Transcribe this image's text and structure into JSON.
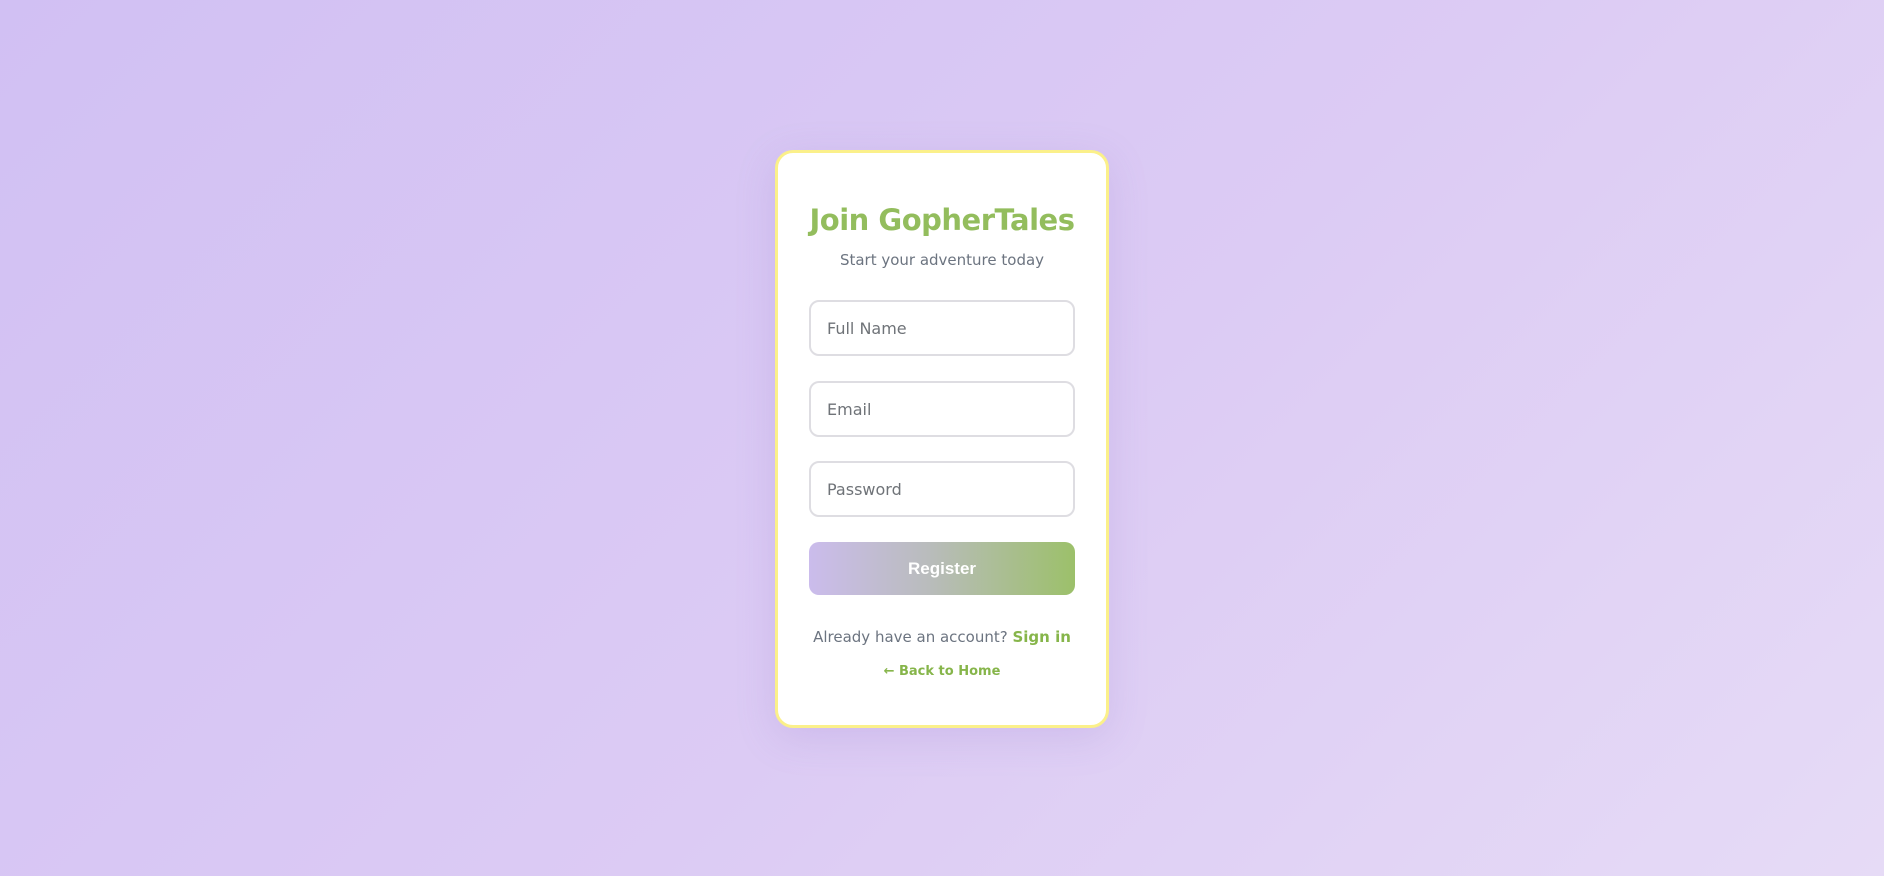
{
  "card": {
    "title": "Join GopherTales",
    "subtitle": "Start your adventure today"
  },
  "form": {
    "name_placeholder": "Full Name",
    "name_value": "",
    "email_placeholder": "Email",
    "email_value": "",
    "password_placeholder": "Password",
    "password_value": "",
    "register_label": "Register"
  },
  "footer": {
    "signin_prompt": "Already have an account?",
    "signin_link": "Sign in",
    "back_link": "← Back to Home"
  },
  "colors": {
    "accent_green": "#93bd5d",
    "card_border": "#fbf08a",
    "background": "#d8c9f3"
  }
}
